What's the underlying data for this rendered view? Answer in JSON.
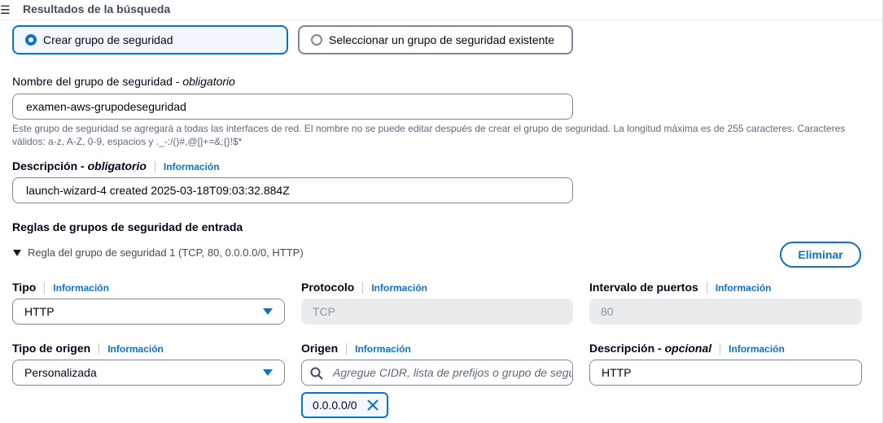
{
  "topbar": {
    "menu_icon": "☰",
    "title": "Resultados de la búsqueda"
  },
  "group_mode": {
    "create_label": "Crear grupo de seguridad",
    "select_label": "Seleccionar un grupo de seguridad existente",
    "selected": "create"
  },
  "name_field": {
    "label": "Nombre del grupo de seguridad - ",
    "required": "obligatorio",
    "value": "examen-aws-grupodeseguridad",
    "hint_1": "Este grupo de seguridad se agregará a todas las interfaces de red. El nombre no se puede editar después de crear el grupo de seguridad. La longitud máxima es de 255 caracteres. Caracteres",
    "hint_2": "válidos: a-z, A-Z, 0-9, espacios y ._-:/()#,@[]+=&;{}!$*"
  },
  "description_field": {
    "label": "Descripción - ",
    "required": "obligatorio",
    "info": "Información",
    "value": "launch-wizard-4 created 2025-03-18T09:03:32.884Z"
  },
  "inbound": {
    "heading": "Reglas de grupos de seguridad de entrada",
    "rule_title": "Regla del grupo de seguridad 1 (TCP, 80, 0.0.0.0/0, HTTP)",
    "delete_label": "Eliminar",
    "type_label": "Tipo",
    "type_info": "Información",
    "type_value": "HTTP",
    "protocol_label": "Protocolo",
    "protocol_info": "Información",
    "protocol_value": "TCP",
    "port_label": "Intervalo de puertos",
    "port_info": "Información",
    "port_value": "80",
    "source_type_label": "Tipo de origen",
    "source_type_info": "Información",
    "source_type_value": "Personalizada",
    "source_label": "Origen",
    "source_info": "Información",
    "source_placeholder": "Agregue CIDR, lista de prefijos o grupo de segu",
    "source_chip": "0.0.0.0/0",
    "rule_desc_label": "Descripción - ",
    "rule_desc_optional": "opcional",
    "rule_desc_info": "Información",
    "rule_desc_value": "HTTP"
  },
  "colors": {
    "accent": "#0972d3",
    "border": "#7d8998",
    "disabled_bg": "#e9ebed"
  }
}
